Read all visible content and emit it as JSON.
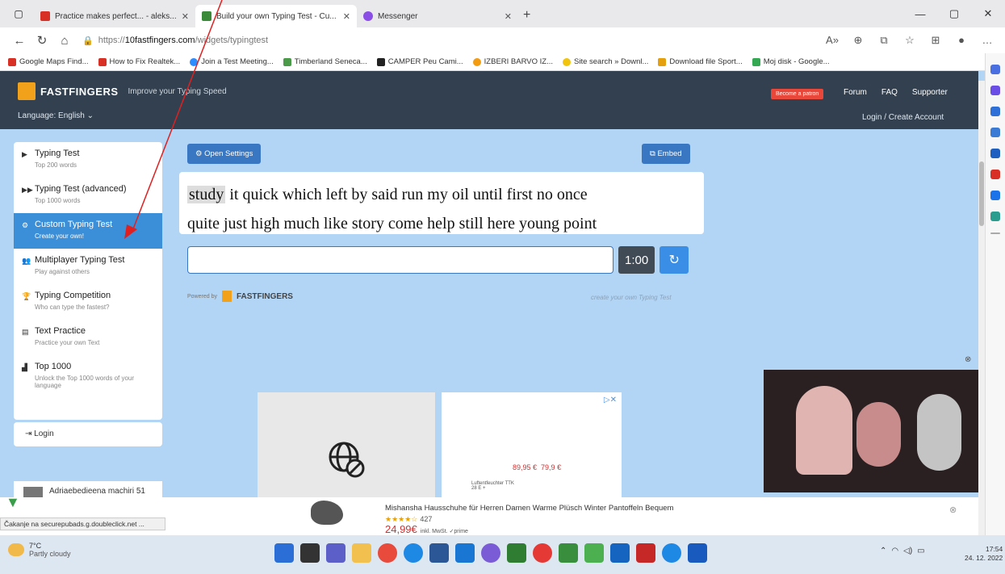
{
  "browser": {
    "tabs": [
      {
        "title": "Practice makes perfect... - aleks...",
        "active": false,
        "color": "#d93025"
      },
      {
        "title": "Build your own Typing Test - Cu...",
        "active": true,
        "color": "#3a8a3a"
      },
      {
        "title": "Messenger",
        "active": false,
        "color": "#8a4de6"
      }
    ],
    "url_prefix": "https://",
    "url_domain": "10fastfingers.com",
    "url_path": "/widgets/typingtest",
    "bookmarks": [
      {
        "label": "Google Maps Find...",
        "color": "#d93025"
      },
      {
        "label": "How to Fix Realtek...",
        "color": "#d93025"
      },
      {
        "label": "Join a Test Meeting...",
        "color": "#2d8cff"
      },
      {
        "label": "Timberland Seneca...",
        "color": "#4a9a4a"
      },
      {
        "label": "CAMPER Peu Cami...",
        "color": "#222"
      },
      {
        "label": "IZBERI BARVO IZ...",
        "color": "#f39c12"
      },
      {
        "label": "Site search » Downl...",
        "color": "#f1c40f"
      },
      {
        "label": "Download file Sport...",
        "color": "#e5a00d"
      },
      {
        "label": "Moj disk - Google...",
        "color": "#34a853"
      }
    ],
    "status_text": "Čakanje na securepubads.g.doubleclick.net ..."
  },
  "site": {
    "logo_text": "FASTFINGERS",
    "tagline": "Improve your Typing Speed",
    "language": "Language: English",
    "patron_button": "Become a patron",
    "top_links": [
      "Forum",
      "FAQ",
      "Supporter"
    ],
    "login_create": "Login / Create Account"
  },
  "menu": {
    "items": [
      {
        "icon": "▶",
        "title": "Typing Test",
        "sub": "Top 200 words",
        "active": false
      },
      {
        "icon": "▶▶",
        "title": "Typing Test (advanced)",
        "sub": "Top 1000 words",
        "active": false
      },
      {
        "icon": "⚙",
        "title": "Custom Typing Test",
        "sub": "Create your own!",
        "active": true
      },
      {
        "icon": "👥",
        "title": "Multiplayer Typing Test",
        "sub": "Play against others",
        "active": false
      },
      {
        "icon": "🏆",
        "title": "Typing Competition",
        "sub": "Who can type the fastest?",
        "active": false
      },
      {
        "icon": "▤",
        "title": "Text Practice",
        "sub": "Practice your own Text",
        "active": false
      },
      {
        "icon": "▟",
        "title": "Top 1000",
        "sub": "Unlock the Top 1000 words of your language",
        "active": false
      }
    ],
    "login_label": "Login",
    "ad_label": "Adriaebedieena machiri 51"
  },
  "widget": {
    "open_settings": "Open Settings",
    "embed": "Embed",
    "current_word": "study",
    "line1_rest": " it quick which left by said run my oil until first no once",
    "line2": "quite just high much like story come help still here young point",
    "input_value": "",
    "timer": "1:00",
    "powered_by": "Powered by",
    "create_own": "create your own Typing Test"
  },
  "ads": {
    "price_a": "89,95 €",
    "price_b": "79,9 €",
    "small_text": "Luftentfeuchter TTK 28 E +",
    "bottom_title": "Mishansha Hausschuhe für Herren Damen Warme Plüsch Winter Pantoffeln Bequem",
    "bottom_stars": "★★★★☆",
    "bottom_reviews": "427",
    "bottom_price": "24,99€",
    "bottom_vat": "inkl. MwSt. ✓prime"
  },
  "taskbar": {
    "temp": "7°C",
    "weather": "Partly cloudy",
    "time": "17:54",
    "date": "24. 12. 2022"
  },
  "colors": {
    "accent": "#3b8fd9",
    "header_bg": "#32404f",
    "page_bg": "#b2d5f5"
  }
}
